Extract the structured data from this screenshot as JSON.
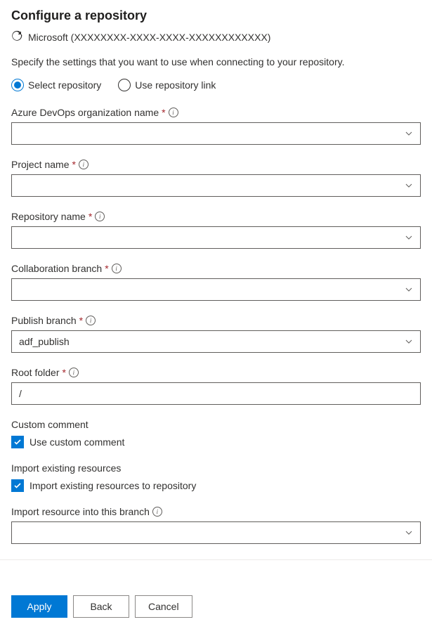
{
  "header": {
    "title": "Configure a repository",
    "account": "Microsoft (XXXXXXXX-XXXX-XXXX-XXXXXXXXXXXX)",
    "description": "Specify the settings that you want to use when connecting to your repository."
  },
  "connection_mode": {
    "options": [
      {
        "label": "Select repository",
        "selected": true
      },
      {
        "label": "Use repository link",
        "selected": false
      }
    ]
  },
  "fields": {
    "org_name": {
      "label": "Azure DevOps organization name",
      "required": true,
      "info": true,
      "value": ""
    },
    "project": {
      "label": "Project name",
      "required": true,
      "info": true,
      "value": ""
    },
    "repo": {
      "label": "Repository name",
      "required": true,
      "info": true,
      "value": ""
    },
    "collab": {
      "label": "Collaboration branch",
      "required": true,
      "info": true,
      "value": ""
    },
    "publish": {
      "label": "Publish branch",
      "required": true,
      "info": true,
      "value": "adf_publish"
    },
    "root": {
      "label": "Root folder",
      "required": true,
      "info": true,
      "value": "/"
    }
  },
  "custom_comment": {
    "header": "Custom comment",
    "checkbox_label": "Use custom comment",
    "checked": true
  },
  "import_resources": {
    "header": "Import existing resources",
    "checkbox_label": "Import existing resources to repository",
    "checked": true,
    "branch_label": "Import resource into this branch",
    "branch_info": true,
    "branch_value": ""
  },
  "footer": {
    "apply": "Apply",
    "back": "Back",
    "cancel": "Cancel"
  }
}
